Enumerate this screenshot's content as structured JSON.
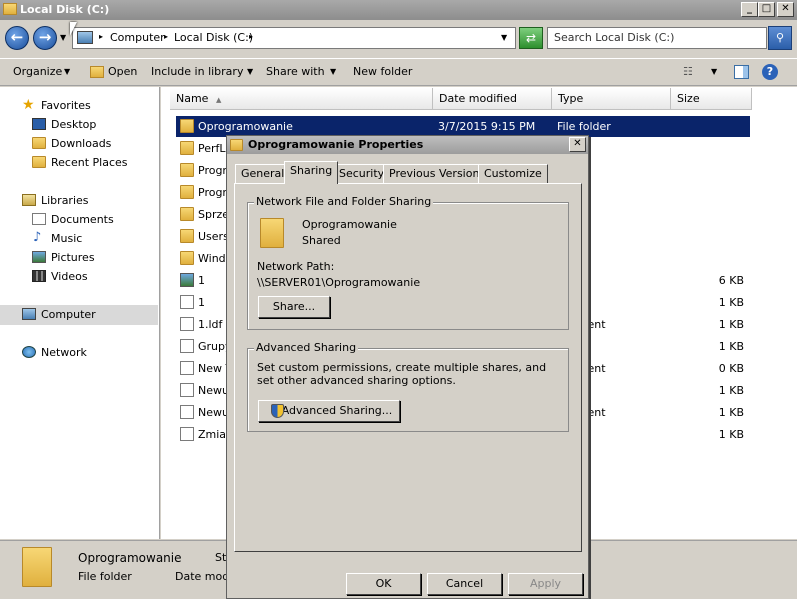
{
  "window": {
    "title": "Local Disk (C:)"
  },
  "address": {
    "segments": [
      "Computer",
      "Local Disk (C:)"
    ]
  },
  "search": {
    "placeholder": "Search Local Disk (C:)"
  },
  "toolbar": {
    "organize": "Organize",
    "open": "Open",
    "include": "Include in library",
    "share": "Share with",
    "newfolder": "New folder"
  },
  "nav": {
    "favorites": "Favorites",
    "desktop": "Desktop",
    "downloads": "Downloads",
    "recent": "Recent Places",
    "libraries": "Libraries",
    "documents": "Documents",
    "music": "Music",
    "pictures": "Pictures",
    "videos": "Videos",
    "computer": "Computer",
    "network": "Network"
  },
  "columns": {
    "name": "Name",
    "date": "Date modified",
    "type": "Type",
    "size": "Size"
  },
  "files": [
    {
      "name": "Oprogramowanie",
      "date": "3/7/2015 9:15 PM",
      "type": "File folder",
      "size": "",
      "icon": "folder"
    },
    {
      "name": "PerfL",
      "date": "",
      "type": "older",
      "size": "",
      "icon": "folder"
    },
    {
      "name": "Progr",
      "date": "",
      "type": "older",
      "size": "",
      "icon": "folder"
    },
    {
      "name": "Progr",
      "date": "",
      "type": "older",
      "size": "",
      "icon": "folder"
    },
    {
      "name": "Sprze",
      "date": "",
      "type": "older",
      "size": "",
      "icon": "folder"
    },
    {
      "name": "Users",
      "date": "",
      "type": "older",
      "size": "",
      "icon": "folder"
    },
    {
      "name": "Windo",
      "date": "",
      "type": "older",
      "size": "",
      "icon": "folder"
    },
    {
      "name": "1",
      "date": "",
      "type": "nage",
      "size": "6 KB",
      "icon": "image"
    },
    {
      "name": "1",
      "date": "",
      "type": "e",
      "size": "1 KB",
      "icon": "file"
    },
    {
      "name": "1.ldf",
      "date": "",
      "type": "ocument",
      "size": "1 KB",
      "icon": "file"
    },
    {
      "name": "Grupy",
      "date": "",
      "type": "e",
      "size": "1 KB",
      "icon": "file"
    },
    {
      "name": "New T",
      "date": "",
      "type": "ocument",
      "size": "0 KB",
      "icon": "file"
    },
    {
      "name": "Newu",
      "date": "",
      "type": "e",
      "size": "1 KB",
      "icon": "file"
    },
    {
      "name": "Newu",
      "date": "",
      "type": "ocument",
      "size": "1 KB",
      "icon": "file"
    },
    {
      "name": "Zmian",
      "date": "",
      "type": "e",
      "size": "1 KB",
      "icon": "file"
    }
  ],
  "details": {
    "name": "Oprogramowanie",
    "type": "File folder",
    "date_label": "Date modi",
    "st_label": "St"
  },
  "dialog": {
    "title": "Oprogramowanie Properties",
    "tabs": [
      "General",
      "Sharing",
      "Security",
      "Previous Versions",
      "Customize"
    ],
    "active_tab": "Sharing",
    "nfs_group": "Network File and Folder Sharing",
    "folder_name": "Oprogramowanie",
    "folder_status": "Shared",
    "path_label": "Network Path:",
    "path_value": "\\\\SERVER01\\Oprogramowanie",
    "share_button": "Share...",
    "adv_group": "Advanced Sharing",
    "adv_text": "Set custom permissions, create multiple shares, and set other advanced sharing options.",
    "adv_button": "Advanced Sharing...",
    "ok": "OK",
    "cancel": "Cancel",
    "apply": "Apply"
  }
}
